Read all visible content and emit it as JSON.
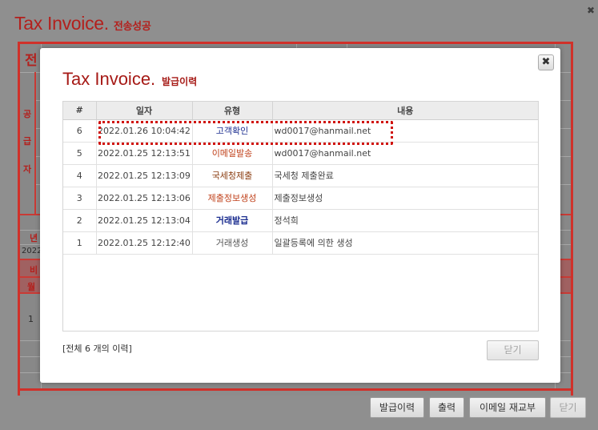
{
  "background": {
    "title": "Tax Invoice.",
    "subtitle": "전송성공",
    "close_icon": "close-icon",
    "left_labels": [
      "전",
      "공",
      "급",
      "자",
      "년",
      "2022",
      "비",
      "월",
      "1"
    ],
    "accent_color": "#d0312a"
  },
  "buttons": {
    "issue_history": "발급이력",
    "print": "출력",
    "resend_email": "이메일 재교부",
    "close": "닫기"
  },
  "modal": {
    "title": "Tax Invoice.",
    "subtitle": "발급이력",
    "close_icon": "close-icon",
    "columns": [
      "#",
      "일자",
      "유형",
      "내용"
    ],
    "rows": [
      {
        "no": "6",
        "date": "2022.01.26 10:04:42",
        "type": "고객확인",
        "content": "wd0017@hanmail.net"
      },
      {
        "no": "5",
        "date": "2022.01.25 12:13:51",
        "type": "이메일발송",
        "content": "wd0017@hanmail.net"
      },
      {
        "no": "4",
        "date": "2022.01.25 12:13:09",
        "type": "국세청제출",
        "content": "국세청 제출완료"
      },
      {
        "no": "3",
        "date": "2022.01.25 12:13:06",
        "type": "제출정보생성",
        "content": "제출정보생성"
      },
      {
        "no": "2",
        "date": "2022.01.25 12:13:04",
        "type": "거래발급",
        "content": "정석희"
      },
      {
        "no": "1",
        "date": "2022.01.25 12:12:40",
        "type": "거래생성",
        "content": "일괄등록에 의한 생성"
      }
    ],
    "footer_count": "[전체 6 개의 이력]",
    "close_button": "닫기",
    "highlight_color": "#d0120d"
  }
}
